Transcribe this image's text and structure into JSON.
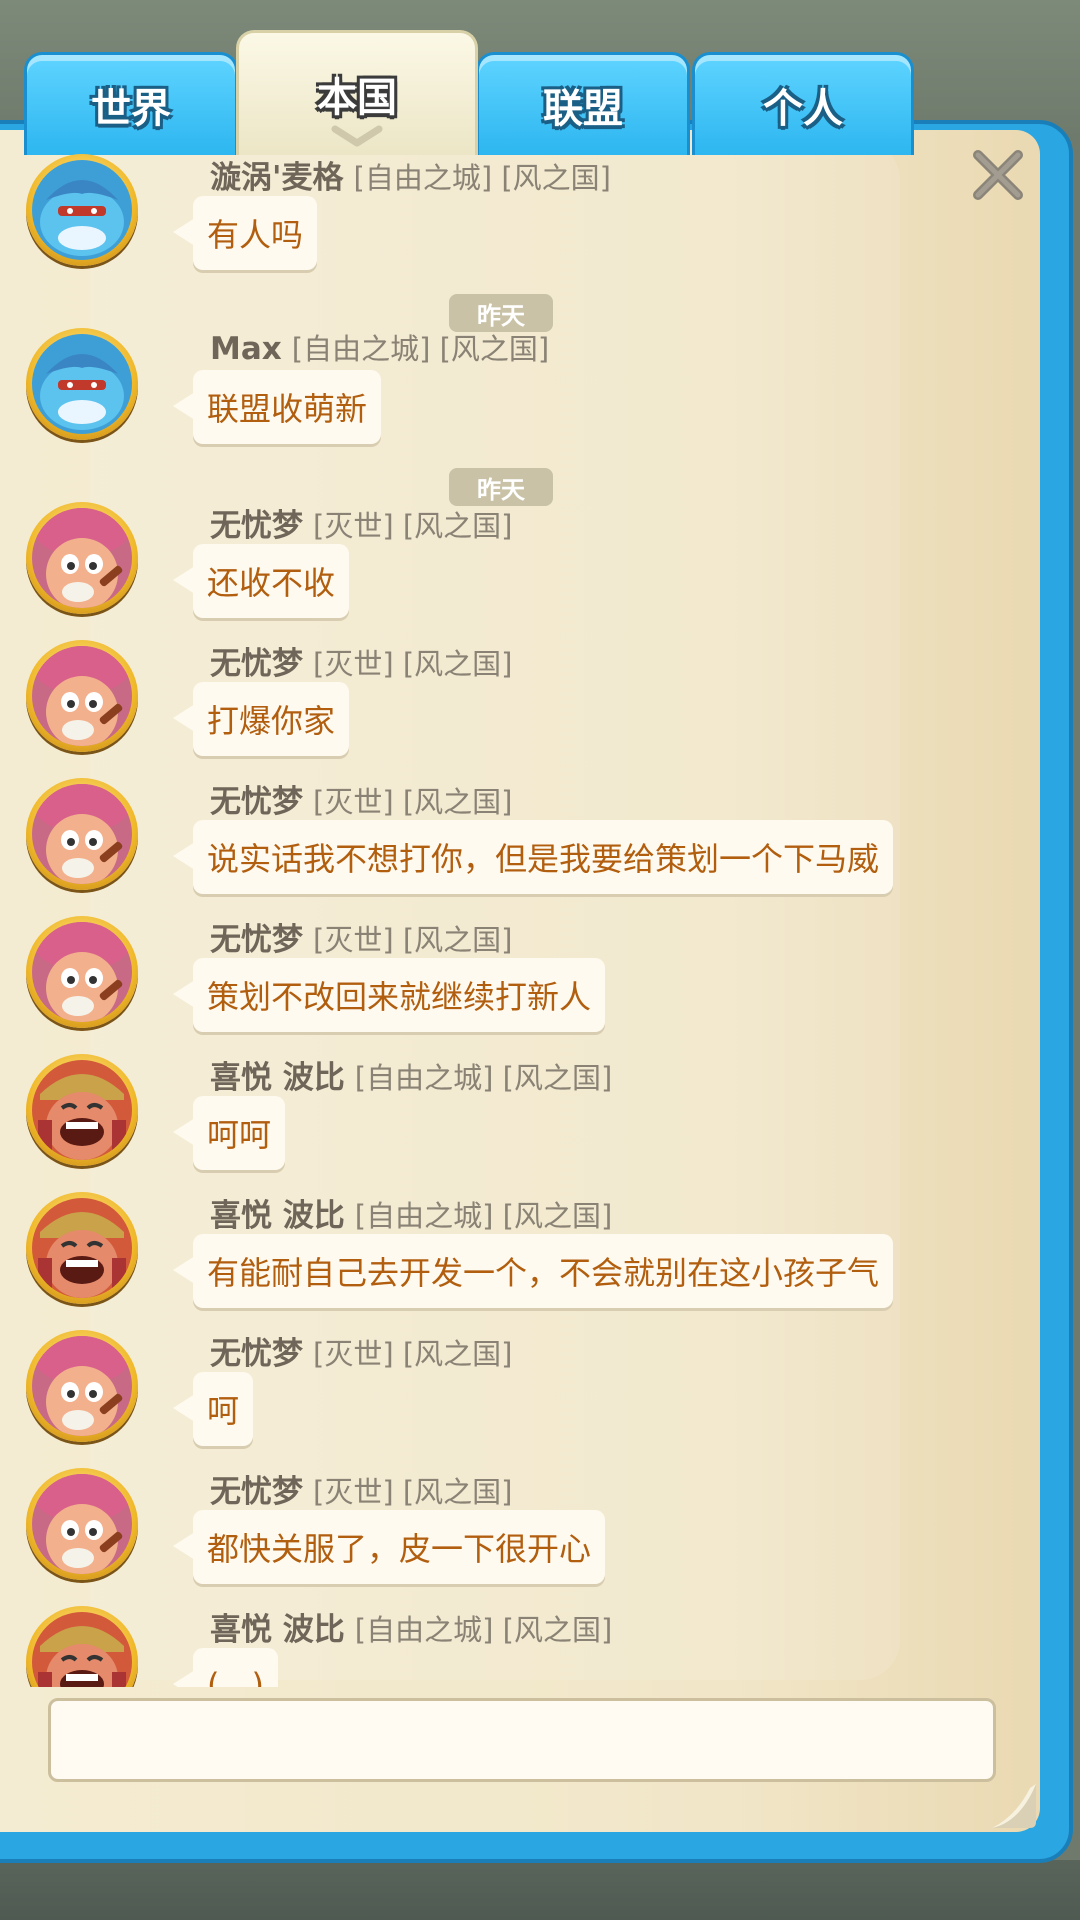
{
  "tabs": [
    {
      "label": "世界",
      "active": false
    },
    {
      "label": "本国",
      "active": true
    },
    {
      "label": "联盟",
      "active": false
    },
    {
      "label": "个人",
      "active": false
    }
  ],
  "colors": {
    "accent": "#2aa6e2",
    "message_text": "#b15e0f",
    "panel": "#f4ecd2"
  },
  "messages": [
    {
      "type": "msg",
      "avatar": "blue-shark-avatar",
      "name": "漩涡'麦格",
      "tags": "[自由之城] [风之国]",
      "text": "有人吗"
    },
    {
      "type": "date",
      "label": "昨天"
    },
    {
      "type": "msg",
      "avatar": "blue-shark-avatar",
      "name": "Max",
      "tags": "[自由之城] [风之国]",
      "text": "联盟收萌新"
    },
    {
      "type": "date",
      "label": "昨天"
    },
    {
      "type": "msg",
      "avatar": "pink-hat-avatar",
      "name": "无忧梦",
      "tags": "[灭世] [风之国]",
      "text": "还收不收"
    },
    {
      "type": "msg",
      "avatar": "pink-hat-avatar",
      "name": "无忧梦",
      "tags": "[灭世] [风之国]",
      "text": "打爆你家"
    },
    {
      "type": "msg",
      "avatar": "pink-hat-avatar",
      "name": "无忧梦",
      "tags": "[灭世] [风之国]",
      "text": "说实话我不想打你，但是我要给策划一个下马威"
    },
    {
      "type": "msg",
      "avatar": "pink-hat-avatar",
      "name": "无忧梦",
      "tags": "[灭世] [风之国]",
      "text": "策划不改回来就继续打新人"
    },
    {
      "type": "msg",
      "avatar": "laughing-warrior-avatar",
      "name": "喜悦 波比",
      "tags": "[自由之城] [风之国]",
      "text": "呵呵"
    },
    {
      "type": "msg",
      "avatar": "laughing-warrior-avatar",
      "name": "喜悦 波比",
      "tags": "[自由之城] [风之国]",
      "text": "有能耐自己去开发一个，不会就别在这小孩子气"
    },
    {
      "type": "msg",
      "avatar": "pink-hat-avatar",
      "name": "无忧梦",
      "tags": "[灭世] [风之国]",
      "text": "呵"
    },
    {
      "type": "msg",
      "avatar": "pink-hat-avatar",
      "name": "无忧梦",
      "tags": "[灭世] [风之国]",
      "text": "都快关服了，皮一下很开心"
    },
    {
      "type": "msg",
      "avatar": "laughing-warrior-avatar",
      "name": "喜悦 波比",
      "tags": "[自由之城] [风之国]",
      "text": "(…)"
    }
  ],
  "input": {
    "placeholder": "",
    "value": ""
  }
}
